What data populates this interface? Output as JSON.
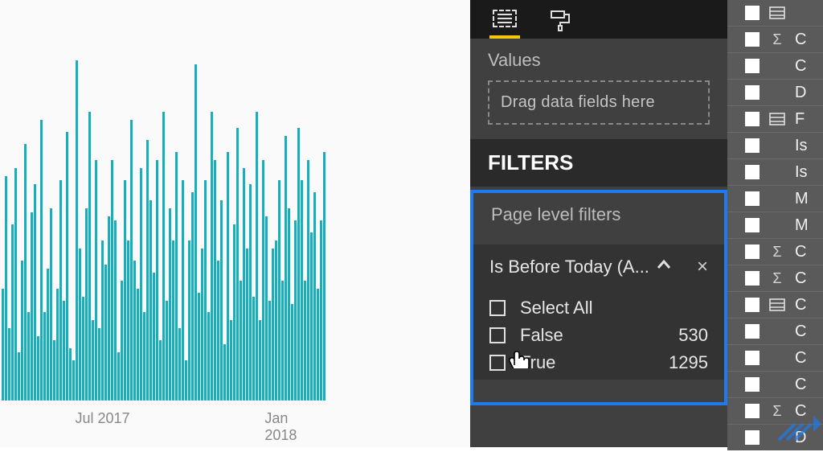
{
  "viz_panel": {
    "values_label": "Values",
    "values_placeholder": "Drag data fields here",
    "filters_header": "FILTERS",
    "page_filters_label": "Page level filters",
    "filter_card": {
      "title": "Is Before Today (A...",
      "options": [
        {
          "label": "Select All",
          "count": null
        },
        {
          "label": "False",
          "count": 530
        },
        {
          "label": "True",
          "count": 1295
        }
      ]
    }
  },
  "fields_panel": {
    "items_visible": [
      {
        "icon": "hierarchy",
        "label": ""
      },
      {
        "icon": "sigma",
        "label": "C"
      },
      {
        "icon": "",
        "label": "C"
      },
      {
        "icon": "",
        "label": "D"
      },
      {
        "icon": "hierarchy",
        "label": "F"
      },
      {
        "icon": "",
        "label": "Is"
      },
      {
        "icon": "",
        "label": "Is"
      },
      {
        "icon": "",
        "label": "M"
      },
      {
        "icon": "",
        "label": "M"
      },
      {
        "icon": "sigma",
        "label": "C"
      },
      {
        "icon": "sigma",
        "label": "C"
      },
      {
        "icon": "hierarchy",
        "label": "C"
      },
      {
        "icon": "",
        "label": "C"
      },
      {
        "icon": "",
        "label": "C"
      },
      {
        "icon": "",
        "label": "C"
      },
      {
        "icon": "sigma",
        "label": "C"
      },
      {
        "icon": "",
        "label": "D"
      }
    ]
  },
  "chart_data": {
    "type": "bar",
    "title": "",
    "xlabel": "",
    "ylabel": "",
    "ylim": [
      0,
      100
    ],
    "x_ticks": [
      {
        "label": "Jul 2017",
        "pos_pct": 30
      },
      {
        "label": "Jan 2018",
        "pos_pct": 85
      }
    ],
    "series": [
      {
        "name": "value",
        "color": "#16b0bd",
        "values": [
          28,
          56,
          18,
          44,
          58,
          12,
          35,
          64,
          22,
          47,
          54,
          16,
          70,
          22,
          33,
          48,
          15,
          28,
          55,
          25,
          67,
          13,
          10,
          85,
          38,
          26,
          48,
          72,
          20,
          60,
          18,
          40,
          34,
          46,
          60,
          45,
          12,
          30,
          55,
          40,
          70,
          35,
          28,
          58,
          22,
          65,
          50,
          32,
          60,
          15,
          72,
          25,
          48,
          40,
          62,
          18,
          55,
          10,
          40,
          52,
          84,
          27,
          38,
          55,
          22,
          72,
          60,
          35,
          50,
          14,
          62,
          20,
          44,
          68,
          30,
          58,
          38,
          54,
          26,
          72,
          20,
          60,
          46,
          25,
          38,
          40,
          55,
          30,
          66,
          48,
          24,
          45,
          68,
          55,
          30,
          60,
          42,
          52,
          28,
          45,
          62
        ]
      }
    ]
  }
}
